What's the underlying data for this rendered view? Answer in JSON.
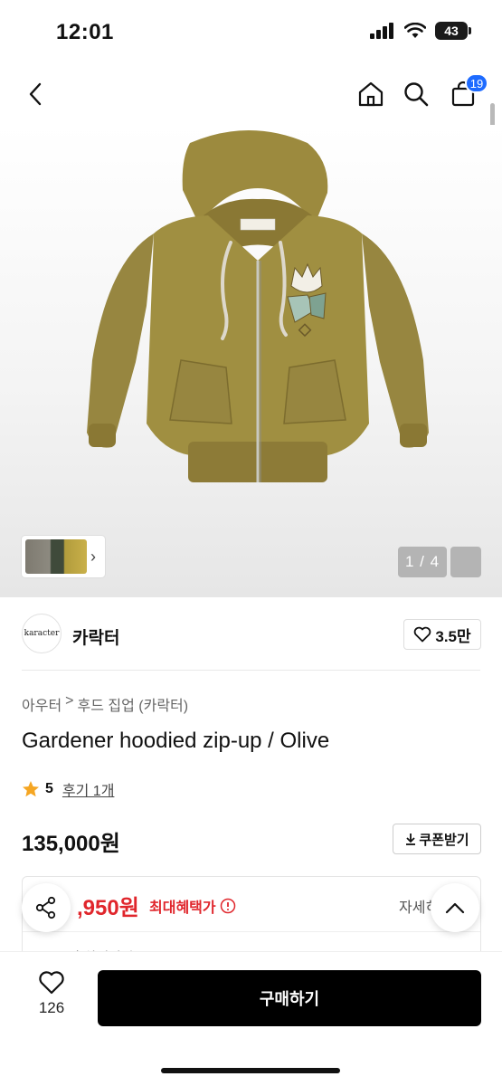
{
  "status": {
    "time": "12:01",
    "battery": "43"
  },
  "nav": {
    "cart_count": "19"
  },
  "gallery": {
    "counter": "1 / 4",
    "thumb_arrow": "›"
  },
  "brand": {
    "logo_text": "karacter",
    "name": "카락터",
    "likes": "3.5만"
  },
  "breadcrumb": [
    "아우터",
    ">",
    "후드 집업 (카락터)"
  ],
  "product": {
    "title": "Gardener hoodied zip-up / Olive",
    "rating": "5",
    "review_link": "후기 1개",
    "price": "135,000원",
    "coupon_label": "쿠폰받기",
    "coupon_icon": "download-icon"
  },
  "benefit": {
    "price_partial": ",950원",
    "label": "최대혜택가",
    "detail": "자세히",
    "sub_text": "7100원 최대적립"
  },
  "bottom": {
    "wish_count": "126",
    "buy_label": "구매하기"
  },
  "colors": {
    "accent_blue": "#1e6bff",
    "sale_red": "#e0262c",
    "star": "#f5a623",
    "hoodie_olive": "#9c8a3e"
  }
}
